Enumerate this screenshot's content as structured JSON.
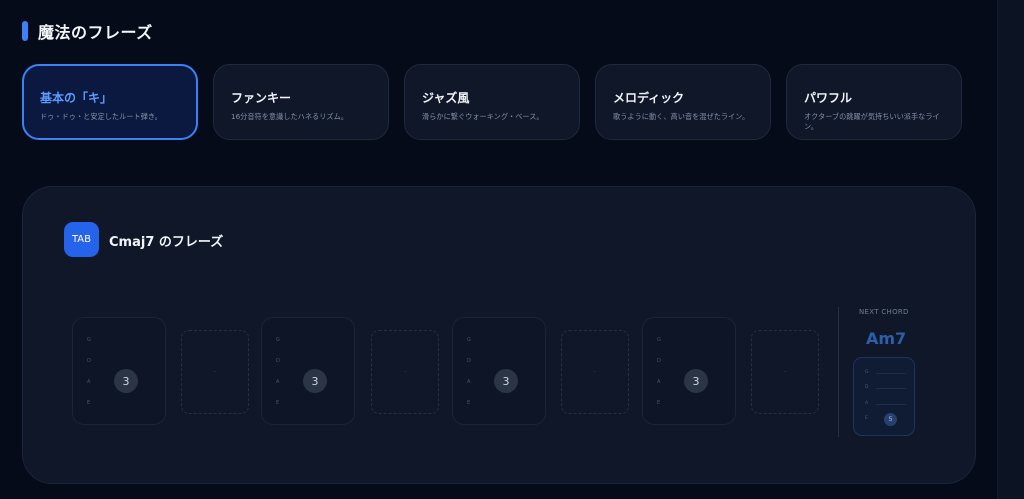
{
  "header": {
    "title": "魔法のフレーズ"
  },
  "styles": [
    {
      "title": "基本の「キ」",
      "desc": "ドゥ・ドゥ・と安定したルート弾き。",
      "active": true
    },
    {
      "title": "ファンキー",
      "desc": "16分音符を意識したハネるリズム。",
      "active": false
    },
    {
      "title": "ジャズ風",
      "desc": "滑らかに繋ぐウォーキング・ベース。",
      "active": false
    },
    {
      "title": "メロディック",
      "desc": "歌うように動く、高い音を混ぜたライン。",
      "active": false
    },
    {
      "title": "パワフル",
      "desc": "オクターブの跳躍が気持ちいい派手なライン。",
      "active": false
    }
  ],
  "panel": {
    "badge": "TAB",
    "title": "Cmaj7 のフレーズ",
    "strings": [
      "G",
      "D",
      "A",
      "E"
    ],
    "beats": [
      {
        "fret": "3",
        "gap": "-"
      },
      {
        "fret": "3",
        "gap": "-"
      },
      {
        "fret": "3",
        "gap": "-"
      },
      {
        "fret": "3",
        "gap": "-"
      }
    ],
    "next": {
      "label": "NEXT CHORD",
      "chord": "Am7",
      "strings": [
        "G",
        "D",
        "A",
        "E"
      ],
      "fret": "5"
    }
  }
}
